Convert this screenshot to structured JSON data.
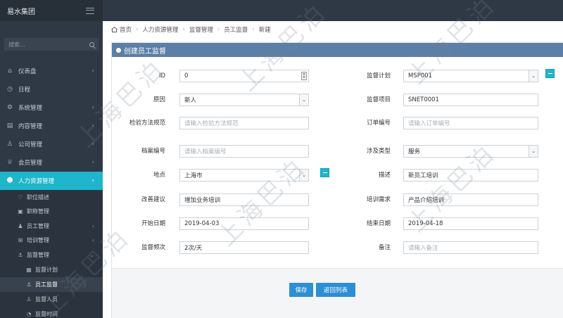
{
  "app": {
    "brand": "易水集团"
  },
  "sidebar": {
    "search_placeholder": "搜索...",
    "items": [
      {
        "label": "仪表盘",
        "icon": "home-icon"
      },
      {
        "label": "日程",
        "icon": "clock-icon"
      },
      {
        "label": "系统管理",
        "icon": "gear-icon"
      },
      {
        "label": "内容管理",
        "icon": "list-icon"
      },
      {
        "label": "公司管理",
        "icon": "org-icon"
      },
      {
        "label": "会员管理",
        "icon": "trophy-icon"
      },
      {
        "label": "人力资源管理",
        "icon": "users-icon"
      }
    ],
    "sub_items": [
      {
        "label": "职位描述",
        "icon": "heart-icon"
      },
      {
        "label": "职称管理",
        "icon": "badge-icon"
      },
      {
        "label": "员工管理",
        "icon": "user-icon"
      },
      {
        "label": "培训管理",
        "icon": "training-icon"
      },
      {
        "label": "监督管理",
        "icon": "anchor-icon"
      }
    ],
    "sub2_items": [
      {
        "label": "监督计划",
        "icon": "grid-icon"
      },
      {
        "label": "员工监督",
        "icon": "anchor-icon"
      },
      {
        "label": "监督人员",
        "icon": "person-icon"
      },
      {
        "label": "监督时间",
        "icon": "time-icon"
      }
    ]
  },
  "breadcrumb": [
    "首页",
    "人力资源管理",
    "监督管理",
    "员工监督",
    "新建"
  ],
  "panel": {
    "title": "创建员工监督"
  },
  "form": {
    "id": {
      "label": "ID",
      "value": "0"
    },
    "reason": {
      "label": "原因",
      "value": "新人"
    },
    "method": {
      "label": "检验方法规范",
      "placeholder": "请输入检验方法规范"
    },
    "archive": {
      "label": "档案编号",
      "placeholder": "请输入档案编号"
    },
    "location": {
      "label": "地点",
      "value": "上海市"
    },
    "suggestion": {
      "label": "改善建议",
      "value": "增加业务培训"
    },
    "start_date": {
      "label": "开始日期",
      "value": "2019-04-03"
    },
    "frequency": {
      "label": "监督频次",
      "value": "2次/天"
    },
    "plan": {
      "label": "监督计划",
      "value": "MSP001"
    },
    "project": {
      "label": "监督项目",
      "value": "SNET0001"
    },
    "order": {
      "label": "订单编号",
      "placeholder": "请输入订单编号"
    },
    "type": {
      "label": "涉及类型",
      "value": "服务"
    },
    "description": {
      "label": "描述",
      "value": "新员工培训"
    },
    "training_need": {
      "label": "培训需求",
      "value": "产品介绍培训"
    },
    "end_date": {
      "label": "结束日期",
      "value": "2019-04-18"
    },
    "remark": {
      "label": "备注",
      "placeholder": "请输入备注"
    }
  },
  "buttons": {
    "save": "保存",
    "back": "返回列表"
  },
  "watermark": "上海巴泊"
}
